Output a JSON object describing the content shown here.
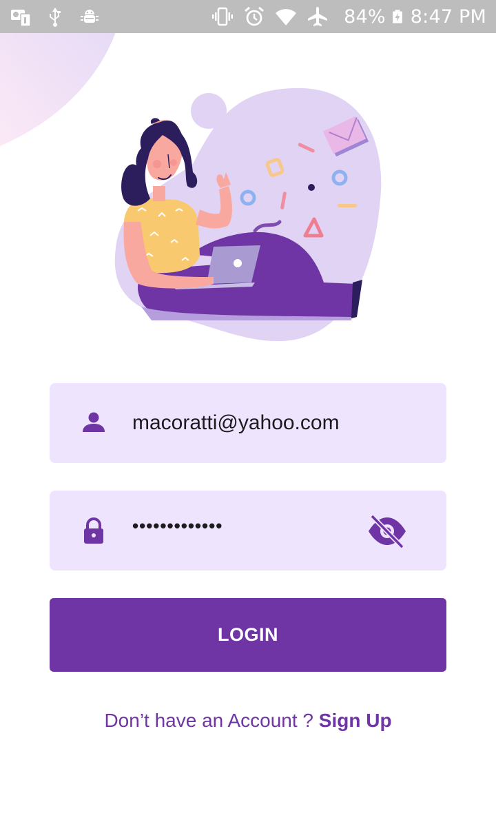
{
  "status_bar": {
    "battery_percent": "84%",
    "time": "8:47 PM",
    "left_icons": [
      "sim-alert-icon",
      "usb-icon",
      "android-debug-icon"
    ],
    "right_icons": [
      "vibrate-icon",
      "alarm-icon",
      "wifi-icon",
      "airplane-mode-icon",
      "battery-charging-icon"
    ]
  },
  "login_form": {
    "email_value": "macoratti@yahoo.com",
    "email_icon": "person-icon",
    "password_value": "*************",
    "password_icon": "lock-icon",
    "visibility_icon": "visibility-off-icon",
    "login_button_label": "LOGIN"
  },
  "signup": {
    "prompt": "Don’t have an Account ? ",
    "link_label": "Sign Up"
  },
  "illustration": "woman-with-laptop-illustration",
  "colors": {
    "primary": "#6f35a5",
    "field_background": "#efe4fd",
    "status_bar": "#bdbdbd",
    "background": "#ffffff"
  }
}
